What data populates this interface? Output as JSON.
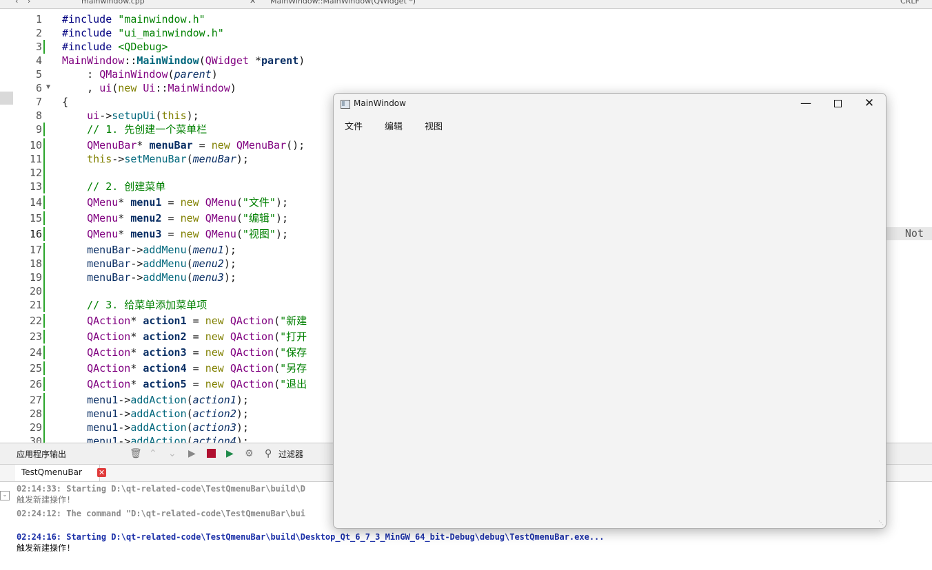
{
  "topbar": {
    "tab1": "mainwindow.cpp",
    "tab2": "MainWindow::MainWindow(QWidget *)",
    "right": "CRLF"
  },
  "editor": {
    "current_line": "16",
    "lines": [
      {
        "n": "1"
      },
      {
        "n": "2"
      },
      {
        "n": "3"
      },
      {
        "n": "4"
      },
      {
        "n": "5"
      },
      {
        "n": "6"
      },
      {
        "n": "7"
      },
      {
        "n": "8"
      },
      {
        "n": "9"
      },
      {
        "n": "10"
      },
      {
        "n": "11"
      },
      {
        "n": "12"
      },
      {
        "n": "13"
      },
      {
        "n": "14"
      },
      {
        "n": "15"
      },
      {
        "n": "16"
      },
      {
        "n": "17"
      },
      {
        "n": "18"
      },
      {
        "n": "19"
      },
      {
        "n": "20"
      },
      {
        "n": "21"
      },
      {
        "n": "22"
      },
      {
        "n": "23"
      },
      {
        "n": "24"
      },
      {
        "n": "25"
      },
      {
        "n": "26"
      },
      {
        "n": "27"
      },
      {
        "n": "28"
      },
      {
        "n": "29"
      },
      {
        "n": "30"
      }
    ],
    "not_badge": "Not"
  },
  "output": {
    "title": "应用程序输出",
    "filter_label": "过滤器",
    "tab_label": "TestQmenuBar",
    "logs": [
      "02:14:33: Starting D:\\qt-related-code\\TestQmenuBar\\build\\D",
      "触发新建操作!",
      "02:24:12: The command \"D:\\qt-related-code\\TestQmenuBar\\bui",
      "02:24:16: Starting D:\\qt-related-code\\TestQmenuBar\\build\\Desktop_Qt_6_7_3_MinGW_64_bit-Debug\\debug\\TestQmenuBar.exe...",
      "触发新建操作!"
    ]
  },
  "mainwindow": {
    "title": "MainWindow",
    "menus": [
      "文件",
      "编辑",
      "视图"
    ]
  }
}
